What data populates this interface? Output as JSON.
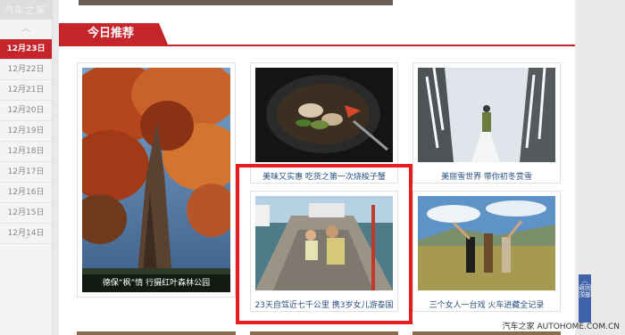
{
  "site": {
    "logo_text": "汽车之家"
  },
  "sidebar": {
    "dates": [
      "12月23日",
      "12月22日",
      "12月21日",
      "12月20日",
      "12月19日",
      "12月18日",
      "12月17日",
      "12月16日",
      "12月15日",
      "12月14日"
    ],
    "active_index": 0
  },
  "section": {
    "title": "今日推荐"
  },
  "cards": {
    "big": {
      "caption": "德保“枫”情 行摄红叶森林公园"
    },
    "food": {
      "caption": "美味又实惠 吃货之第一次烧梭子蟹"
    },
    "snow": {
      "caption": "美丽雪世界 带你初冬赏雪"
    },
    "boat": {
      "caption": "23天自驾近七千公里 携3岁女儿游泰国"
    },
    "women": {
      "caption": "三个女人一台戏 火车进藏全记录"
    }
  },
  "back_to_top": {
    "label": "︿ 返回顶部"
  },
  "watermark": {
    "text": "汽车之家 AUTOHOME.COM.CN"
  },
  "colors": {
    "accent": "#c4242a",
    "highlight": "#e41d1d",
    "link": "#2a4f7c"
  }
}
